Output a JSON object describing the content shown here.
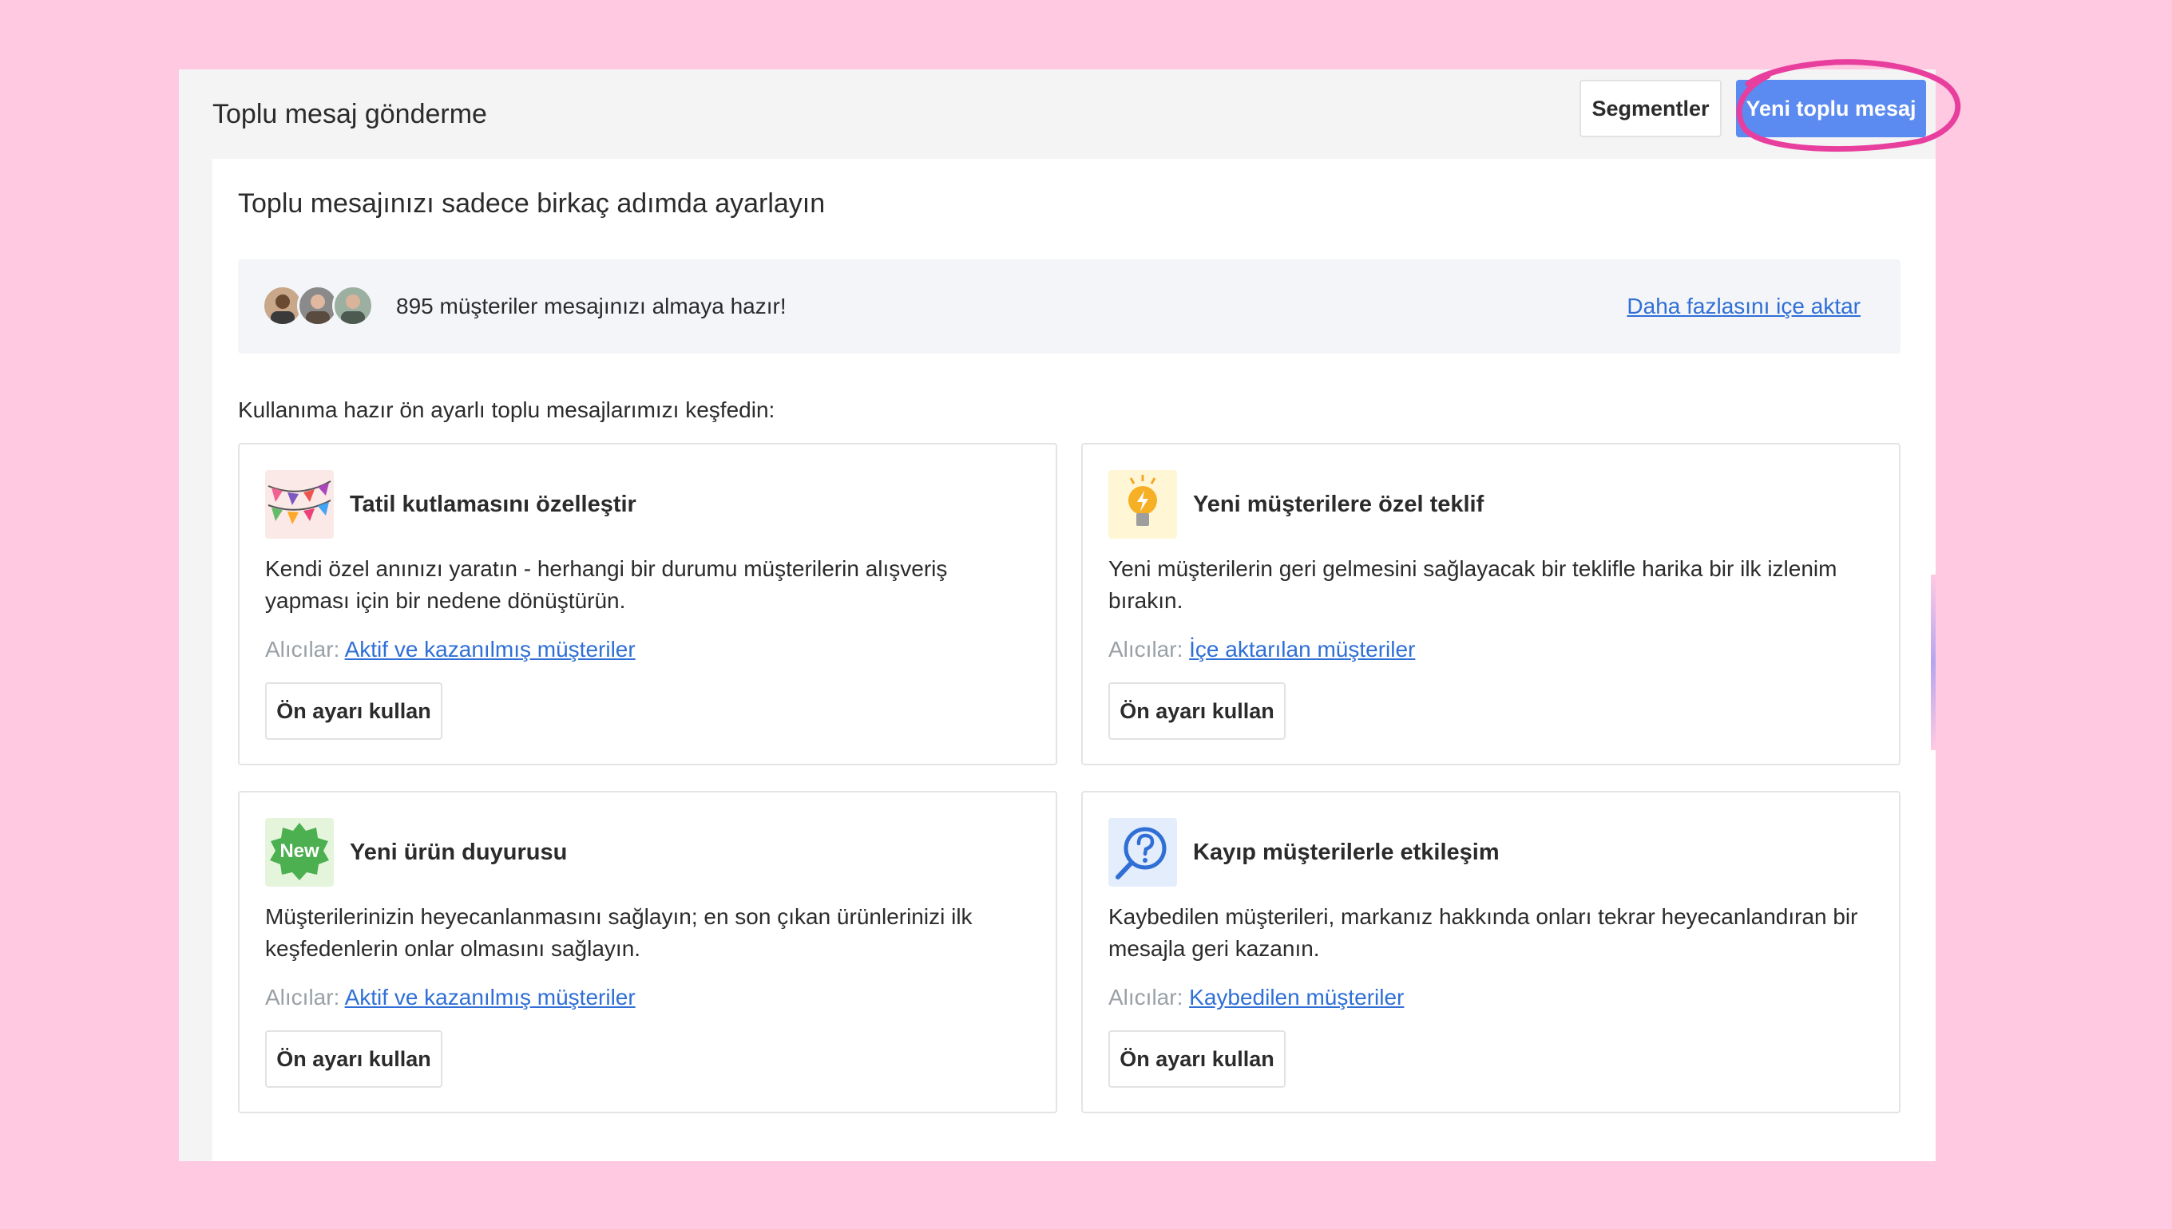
{
  "header": {
    "title": "Toplu mesaj gönderme",
    "segments_label": "Segmentler",
    "new_label": "Yeni toplu mesaj"
  },
  "main": {
    "subtitle": "Toplu mesajınızı sadece birkaç adımda ayarlayın",
    "info": {
      "text": "895 müşteriler mesajınızı almaya hazır!",
      "link": "Daha fazlasını içe aktar"
    },
    "explore": "Kullanıma hazır ön ayarlı toplu mesajlarımızı keşfedin:"
  },
  "cards": [
    {
      "icon": "bunting-flags-icon",
      "title": "Tatil kutlamasını özelleştir",
      "desc": "Kendi özel anınızı yaratın - herhangi bir durumu müşterilerin alışveriş yapması için bir nedene dönüştürün.",
      "rec_label": "Alıcılar:",
      "rec_link": "Aktif ve kazanılmış müşteriler",
      "button": "Ön ayarı kullan"
    },
    {
      "icon": "lightbulb-icon",
      "title": "Yeni müşterilere özel teklif",
      "desc": "Yeni müşterilerin geri gelmesini sağlayacak bir teklifle harika bir ilk izlenim bırakın.",
      "rec_label": "Alıcılar:",
      "rec_link": "İçe aktarılan müşteriler",
      "button": "Ön ayarı kullan"
    },
    {
      "icon": "new-badge-icon",
      "badge_text": "New",
      "title": "Yeni ürün duyurusu",
      "desc": "Müşterilerinizin heyecanlanmasını sağlayın; en son çıkan ürünlerinizi ilk keşfedenlerin onlar olmasını sağlayın.",
      "rec_label": "Alıcılar:",
      "rec_link": "Aktif ve kazanılmış müşteriler",
      "button": "Ön ayarı kullan"
    },
    {
      "icon": "question-magnifier-icon",
      "title": "Kayıp müşterilerle etkileşim",
      "desc": "Kaybedilen müşterileri, markanız hakkında onları tekrar heyecanlandıran bir mesajla geri kazanın.",
      "rec_label": "Alıcılar:",
      "rec_link": "Kaybedilen müşteriler",
      "button": "Ön ayarı kullan"
    }
  ],
  "colors": {
    "background": "#ffc9e1",
    "primary_button": "#5b8af0",
    "link": "#2f6fd6",
    "highlight_stroke": "#e83e9e"
  }
}
